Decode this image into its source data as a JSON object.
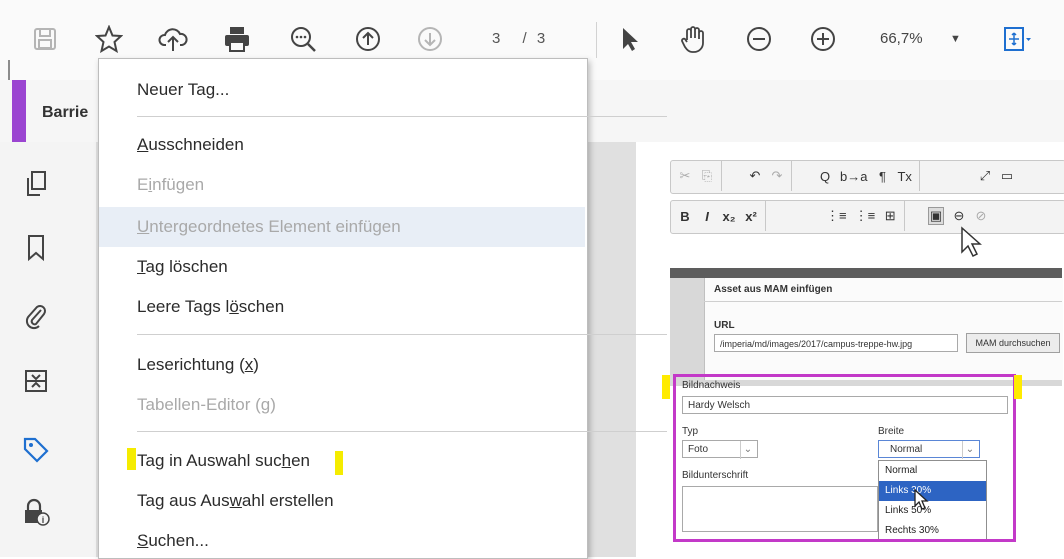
{
  "toolbar": {
    "page_current": "3",
    "page_sep": "/",
    "page_total": "3",
    "zoom_value": "66,7%",
    "icons": [
      "save-icon",
      "star-icon",
      "cloud-upload-icon",
      "print-icon",
      "zoom-search-icon",
      "arrow-up-icon",
      "arrow-down-icon",
      "cursor-icon",
      "hand-icon",
      "zoom-out-icon",
      "zoom-in-icon",
      "fit-page-icon"
    ]
  },
  "doc": {
    "tab_label": "Barrie"
  },
  "leftnav": {
    "icons": [
      "pages-icon",
      "bookmark-icon",
      "attachment-icon",
      "layers-icon",
      "tag-icon",
      "lock-info-icon"
    ]
  },
  "menu": {
    "items": [
      {
        "text": "Neuer Tag...",
        "pre": "Neuer Ta",
        "u": "g",
        "post": "...",
        "enabled": true
      },
      {
        "text": "Ausschneiden",
        "pre": "",
        "u": "A",
        "post": "usschneiden",
        "enabled": true
      },
      {
        "text": "Einfügen",
        "pre": "E",
        "u": "i",
        "post": "nfügen",
        "enabled": false
      },
      {
        "text": "Untergeordnetes Element einfügen",
        "pre": "",
        "u": "U",
        "post": "ntergeordnetes Element einfügen",
        "enabled": false
      },
      {
        "text": "Tag löschen",
        "pre": "",
        "u": "T",
        "post": "ag löschen",
        "enabled": true
      },
      {
        "text": "Leere Tags löschen",
        "pre": "Leere Tags l",
        "u": "ö",
        "post": "schen",
        "enabled": true
      },
      {
        "text": "Leserichtung (x)",
        "pre": "Leserichtung (",
        "u": "x",
        "post": ")",
        "enabled": true
      },
      {
        "text": "Tabellen-Editor (g)",
        "pre": "Tabellen-Editor (",
        "u": "g",
        "post": ")",
        "enabled": false
      },
      {
        "text": "Tag in Auswahl suchen",
        "pre": "Tag in Auswahl suc",
        "u": "h",
        "post": "en",
        "enabled": true
      },
      {
        "text": "Tag aus Auswahl erstellen",
        "pre": "Tag aus Aus",
        "u": "w",
        "post": "ahl erstellen",
        "enabled": true
      },
      {
        "text": "Suchen...",
        "pre": "",
        "u": "S",
        "post": "uchen...",
        "enabled": true
      }
    ]
  },
  "editor": {
    "row1": [
      "✂",
      "⎘",
      "↶",
      "↷",
      "Q",
      "b→a",
      "¶",
      "Tx",
      "⤢",
      "▭"
    ],
    "row2": [
      "B",
      "I",
      "x₂",
      "x²",
      "⋮≡",
      "⋮≡",
      "⊞",
      "▣",
      "⊖",
      "⊘"
    ]
  },
  "dialog": {
    "title": "Asset aus MAM einfügen",
    "url_label": "URL",
    "url_value": "/imperia/md/images/2017/campus-treppe-hw.jpg",
    "browse_button": "MAM durchsuchen",
    "credit_label": "Bildnachweis",
    "credit_value": "Hardy Welsch",
    "type_label": "Typ",
    "type_value": "Foto",
    "width_label": "Breite",
    "width_value": "Normal",
    "caption_label": "Bildunterschrift",
    "width_options": [
      "Normal",
      "Links 30%",
      "Links 50%",
      "Rechts 30%"
    ],
    "selected_option": "Links 30%"
  }
}
